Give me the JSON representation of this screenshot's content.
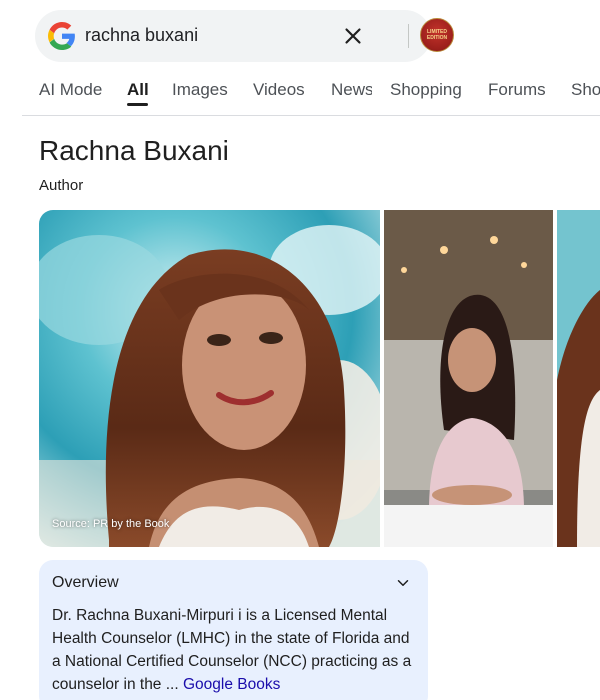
{
  "search": {
    "query": "rachna buxani",
    "doodle_text": "LIMITED EDITION"
  },
  "tabs": [
    "AI Mode",
    "All",
    "Images",
    "Videos",
    "News",
    "Shopping",
    "Forums",
    "Sho"
  ],
  "active_tab": "All",
  "entity": {
    "title": "Rachna Buxani",
    "subtitle": "Author"
  },
  "images": {
    "source_label": "Source: PR by the Book"
  },
  "overview": {
    "title": "Overview",
    "body": "Dr. Rachna Buxani-Mirpuri i is a Licensed Mental Health Counselor (LMHC) in the state of Florida and a National Certified Counselor (NCC) practicing as a counselor in the ... ",
    "link": "Google Books"
  },
  "colors": {
    "link": "#1a0dab",
    "overview_bg": "#e8f0fe",
    "search_bg": "#f1f3f4"
  }
}
